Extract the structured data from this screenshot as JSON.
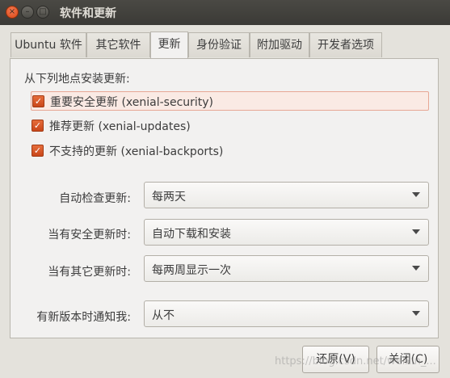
{
  "window": {
    "title": "软件和更新",
    "controls": {
      "close_glyph": "×",
      "minimize_glyph": "–",
      "maximize_glyph": "□"
    }
  },
  "tabs": [
    {
      "label": "Ubuntu 软件",
      "active": false
    },
    {
      "label": "其它软件",
      "active": false
    },
    {
      "label": "更新",
      "active": true
    },
    {
      "label": "身份验证",
      "active": false
    },
    {
      "label": "附加驱动",
      "active": false
    },
    {
      "label": "开发者选项",
      "active": false
    }
  ],
  "updates": {
    "section_label": "从下列地点安装更新:",
    "sources": [
      {
        "label": "重要安全更新 (xenial-security)",
        "checked": true
      },
      {
        "label": "推荐更新 (xenial-updates)",
        "checked": true
      },
      {
        "label": "不支持的更新 (xenial-backports)",
        "checked": true
      }
    ],
    "checkbox_glyph": "✓",
    "settings": [
      {
        "label": "自动检查更新:",
        "value": "每两天"
      },
      {
        "label": "当有安全更新时:",
        "value": "自动下载和安装"
      },
      {
        "label": "当有其它更新时:",
        "value": "每两周显示一次"
      },
      {
        "label": "有新版本时通知我:",
        "value": "从不"
      }
    ]
  },
  "buttons": {
    "revert": "还原(V)",
    "close": "关闭(C)"
  },
  "watermark": "https://blog.csdn.net/weixin_...",
  "colors": {
    "accent": "#dd5522",
    "titlebar": "#3f3e3a",
    "background": "#f2f1f0"
  }
}
